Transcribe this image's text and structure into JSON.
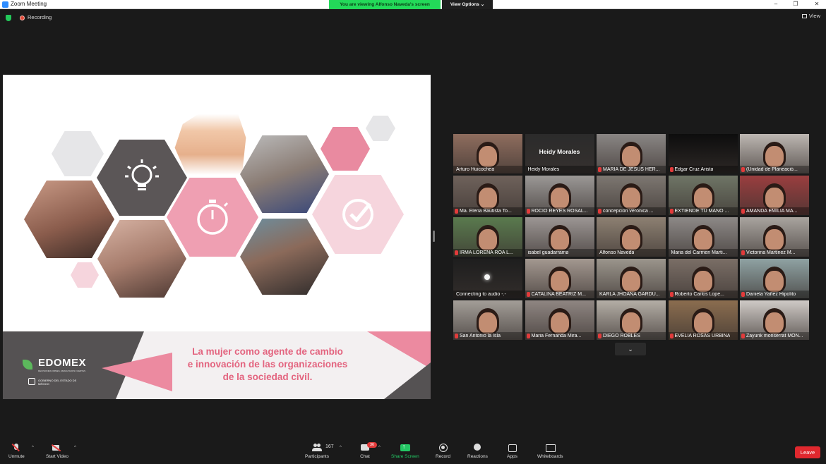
{
  "window": {
    "title": "Zoom Meeting",
    "share_banner": "You are viewing Alfonso Naveda's screen",
    "view_options": "View Options",
    "minimize": "–",
    "maximize": "❐",
    "close": "✕"
  },
  "status": {
    "recording": "Recording",
    "view": "View"
  },
  "slide": {
    "brand": "EDOMEX",
    "brand_tagline": "DECISIONES FIRMES, RESULTADOS FUERTES",
    "government": "GOBIERNO DEL ESTADO DE MÉXICO",
    "title_line1": "La mujer como agente de cambio",
    "title_line2": "e innovación de las organizaciones",
    "title_line3": "de la sociedad civil."
  },
  "gallery": {
    "tiles": [
      {
        "name": "Arturo Huicochea",
        "muted": false,
        "bg": "#8f6d5e",
        "big": ""
      },
      {
        "name": "Heidy Morales",
        "muted": false,
        "bg": "#2b2b2b",
        "big": "Heidy Morales"
      },
      {
        "name": "MARIA DE JESUS HER...",
        "muted": true,
        "bg": "#8a8684",
        "big": ""
      },
      {
        "name": "Edgar Cruz Arista",
        "muted": true,
        "bg": "#0d0d0d",
        "big": ""
      },
      {
        "name": "(Unidad de Planeació...",
        "muted": true,
        "bg": "#bdb7b2",
        "big": ""
      },
      {
        "name": "Ma. Elena Bautista To...",
        "muted": true,
        "bg": "#6f625b",
        "big": ""
      },
      {
        "name": "ROCIO REYES ROSAL...",
        "muted": true,
        "bg": "#9b9896",
        "big": ""
      },
      {
        "name": "concepcion veronica ...",
        "muted": true,
        "bg": "#7d7771",
        "big": ""
      },
      {
        "name": "EXTIENDE TU MANO ...",
        "muted": true,
        "bg": "#6f7566",
        "big": ""
      },
      {
        "name": "AMANDA EMILIA MA...",
        "muted": true,
        "bg": "#9a3e3f",
        "big": ""
      },
      {
        "name": "IRMA LORENA ROA L...",
        "muted": true,
        "bg": "#5a7a4e",
        "big": ""
      },
      {
        "name": "isabel guadarrama",
        "muted": false,
        "bg": "#9c9694",
        "big": ""
      },
      {
        "name": "Alfonso Naveda",
        "muted": false,
        "bg": "#8d8072",
        "big": ""
      },
      {
        "name": "Maria del Carmen Marti...",
        "muted": false,
        "bg": "#8d8987",
        "big": ""
      },
      {
        "name": "Victorina Martinez M...",
        "muted": true,
        "bg": "#a9a49f",
        "big": ""
      },
      {
        "name": "Connecting to audio -.-",
        "muted": false,
        "bg": "#1e1e1e",
        "big": ""
      },
      {
        "name": "CATALINA BEATRIZ M...",
        "muted": true,
        "bg": "#a39890",
        "big": ""
      },
      {
        "name": "KARLA JHOANA GARDU...",
        "muted": false,
        "bg": "#9b958c",
        "big": ""
      },
      {
        "name": "Roberto Carlos Lope...",
        "muted": true,
        "bg": "#7a6e66",
        "big": ""
      },
      {
        "name": "Daniela Yañez Hipolito",
        "muted": true,
        "bg": "#8fa2a3",
        "big": ""
      },
      {
        "name": "San Antonio la Isla",
        "muted": true,
        "bg": "#a39e98",
        "big": ""
      },
      {
        "name": "Maria Fernanda Mira...",
        "muted": true,
        "bg": "#8f8682",
        "big": ""
      },
      {
        "name": "DIEGO ROBLES",
        "muted": true,
        "bg": "#b4aea6",
        "big": ""
      },
      {
        "name": "EVELIA ROSAS URBINA",
        "muted": true,
        "bg": "#8b6d4f",
        "big": ""
      },
      {
        "name": "Zayurik monserrat MON...",
        "muted": true,
        "bg": "#cfcac6",
        "big": ""
      }
    ],
    "more": "⌄"
  },
  "toolbar": {
    "unmute": "Unmute",
    "start_video": "Start Video",
    "participants": "Participants",
    "participants_count": "167",
    "chat": "Chat",
    "chat_badge": "36",
    "share_screen": "Share Screen",
    "record": "Record",
    "reactions": "Reactions",
    "apps": "Apps",
    "whiteboards": "Whiteboards",
    "leave": "Leave"
  },
  "colors": {
    "share_green": "#23d959",
    "leave_red": "#e0282e",
    "accent_pink": "#e3647f",
    "active_speaker": "#c7e63b"
  }
}
